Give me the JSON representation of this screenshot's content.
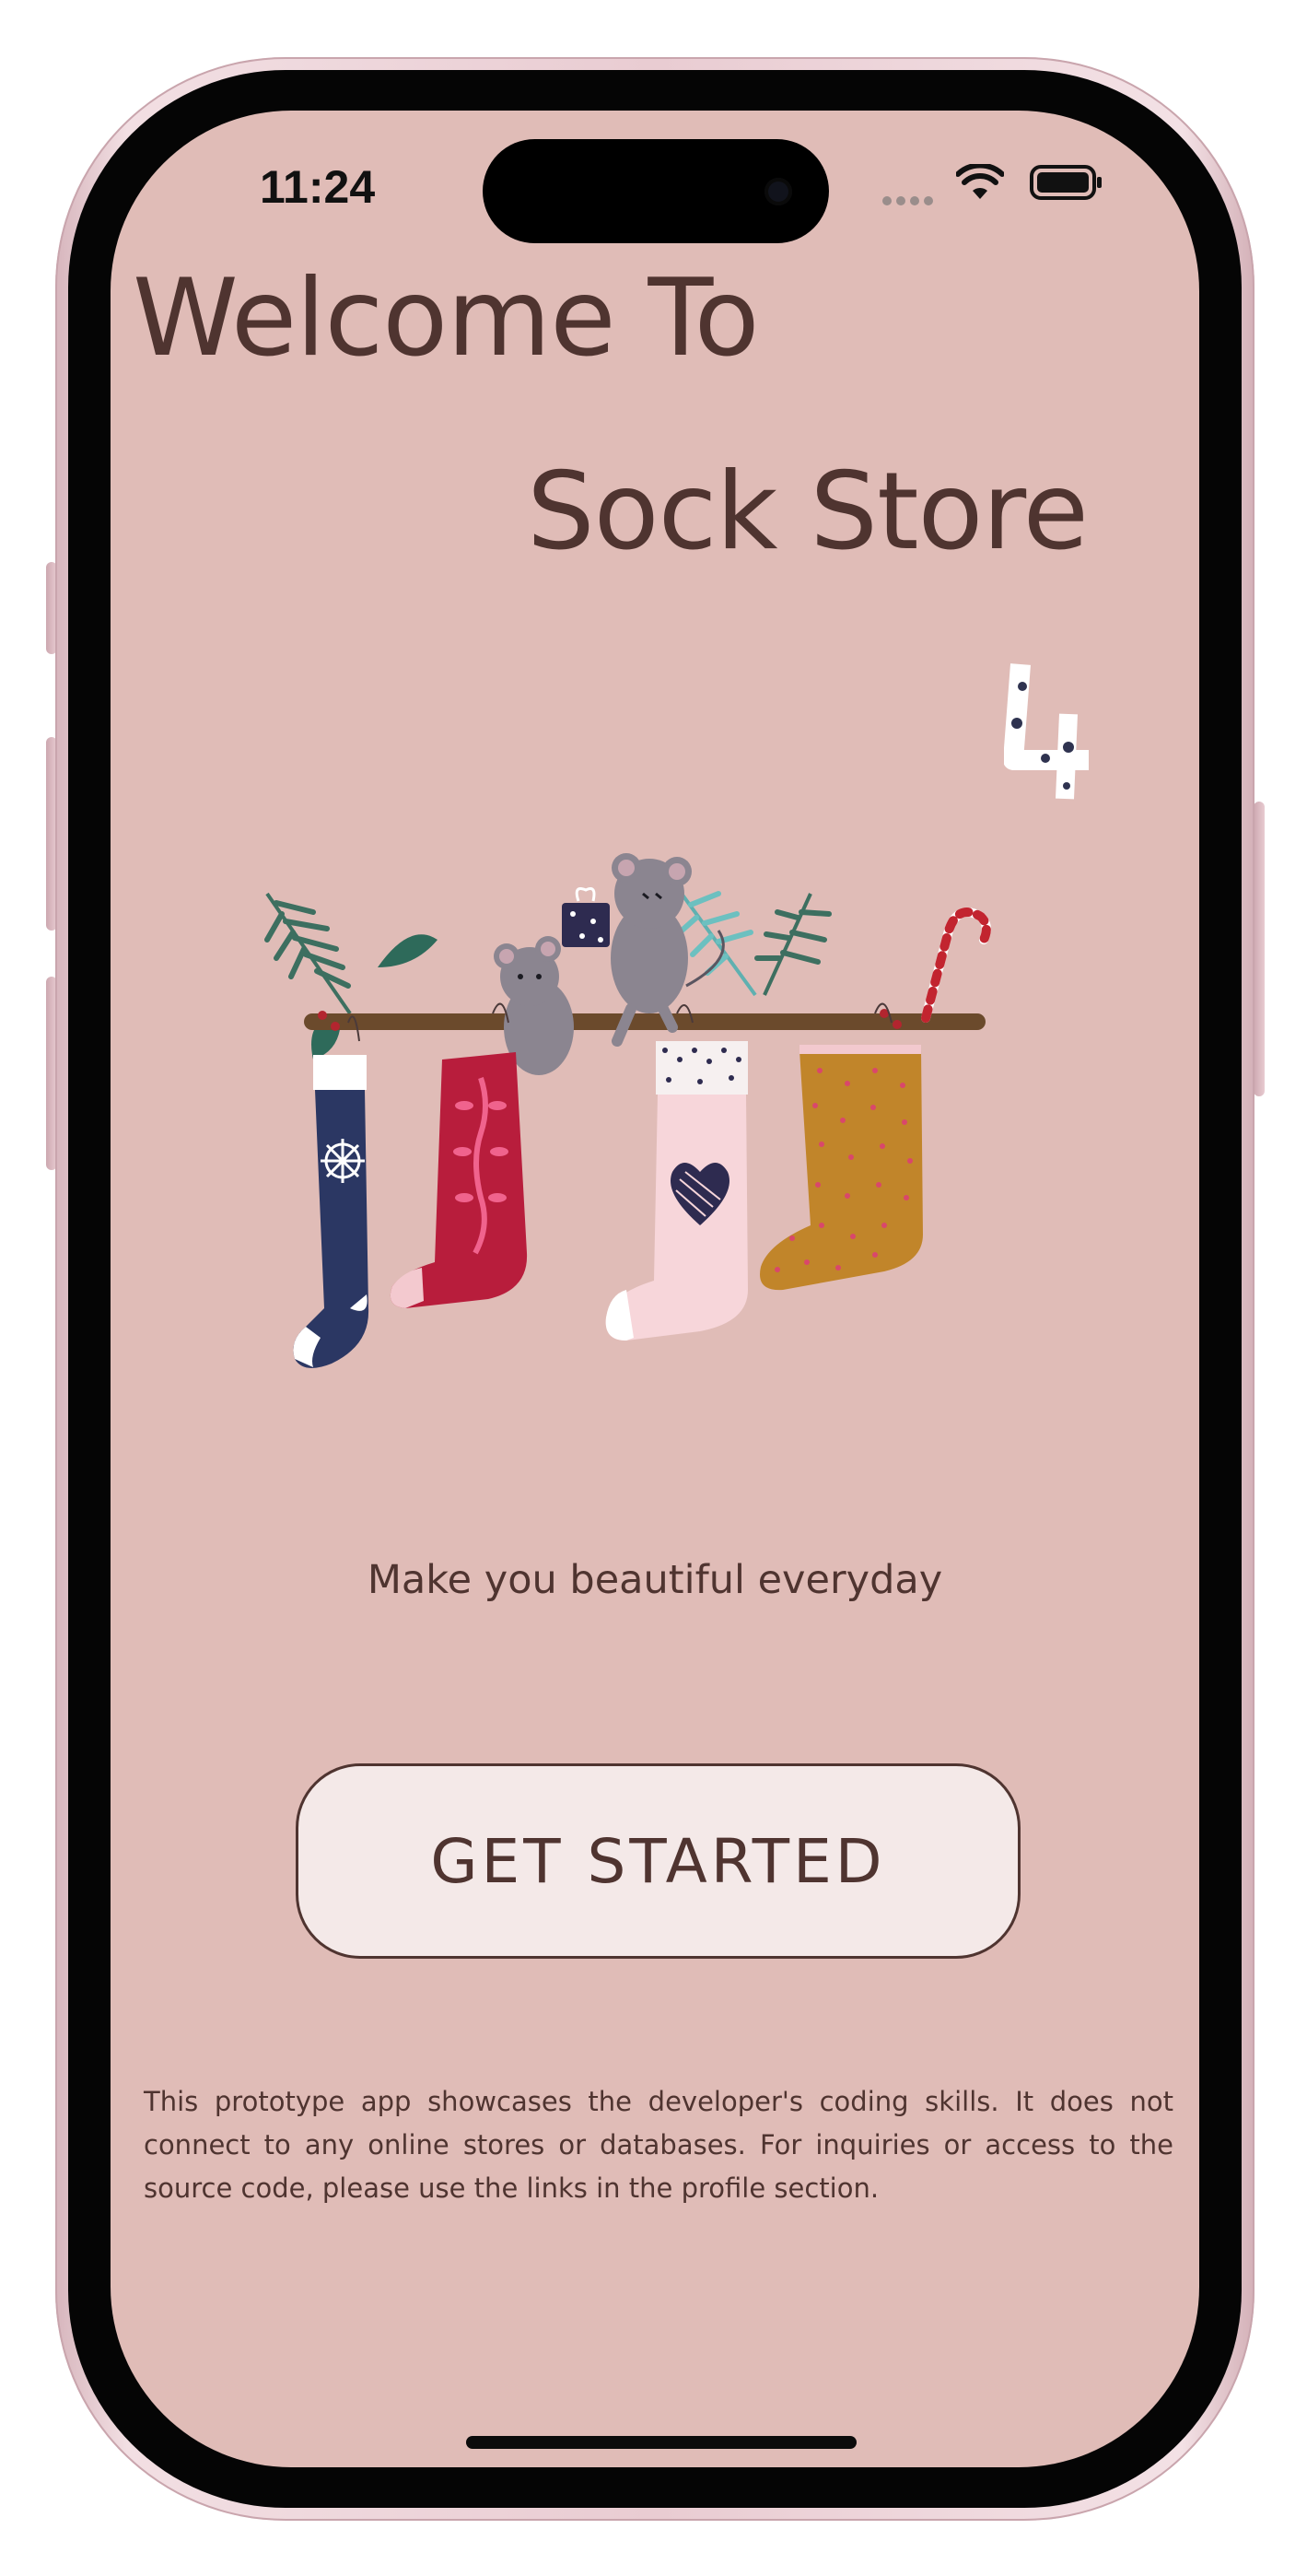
{
  "status_bar": {
    "time": "11:24",
    "icons": [
      "cellular-dots-icon",
      "wifi-icon",
      "battery-icon"
    ]
  },
  "welcome": {
    "line1": "Welcome To",
    "line2": "Sock Store"
  },
  "tagline": "Make you beautiful everyday",
  "get_started_label": "GET STARTED",
  "disclaimer": "This prototype app showcases the developer's coding skills. It does not connect to any online stores or databases. For inquiries or access to the source code, please use the links in the profile section.",
  "colors": {
    "background": "#e0bcb7",
    "text": "#4f3430",
    "button_fill": "#f4e9e8"
  }
}
